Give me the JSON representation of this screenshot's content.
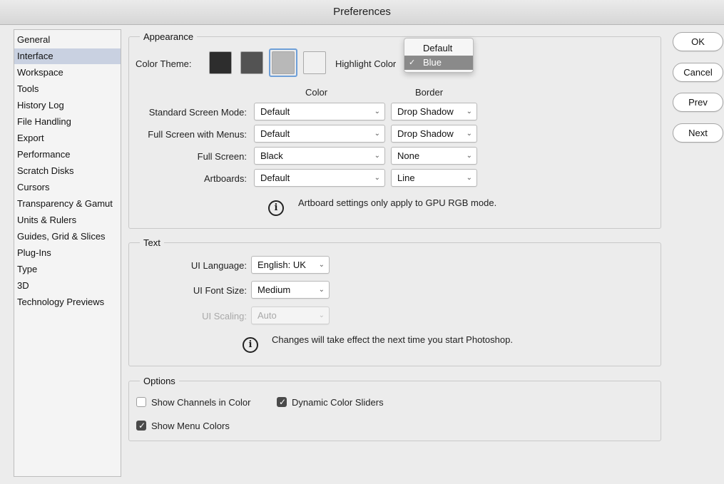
{
  "window": {
    "title": "Preferences"
  },
  "sidebar": {
    "selected": "Interface",
    "items": [
      {
        "label": "General"
      },
      {
        "label": "Interface"
      },
      {
        "label": "Workspace"
      },
      {
        "label": "Tools"
      },
      {
        "label": "History Log"
      },
      {
        "label": "File Handling"
      },
      {
        "label": "Export"
      },
      {
        "label": "Performance"
      },
      {
        "label": "Scratch Disks"
      },
      {
        "label": "Cursors"
      },
      {
        "label": "Transparency & Gamut"
      },
      {
        "label": "Units & Rulers"
      },
      {
        "label": "Guides, Grid & Slices"
      },
      {
        "label": "Plug-Ins"
      },
      {
        "label": "Type"
      },
      {
        "label": "3D"
      },
      {
        "label": "Technology Previews"
      }
    ]
  },
  "appearance": {
    "legend": "Appearance",
    "color_theme_label": "Color Theme:",
    "themes": [
      {
        "color": "#2d2d2d"
      },
      {
        "color": "#535353"
      },
      {
        "color": "#b8b8b8",
        "selected": true
      },
      {
        "color": "#f0f0f0"
      }
    ],
    "highlight_label": "Highlight Color",
    "highlight_popup": {
      "options": [
        "Default",
        "Blue"
      ],
      "selected": "Blue",
      "selected_bg": "#8a8a8a"
    },
    "col_color": "Color",
    "col_border": "Border",
    "rows": [
      {
        "label": "Standard Screen Mode:",
        "color": "Default",
        "border": "Drop Shadow"
      },
      {
        "label": "Full Screen with Menus:",
        "color": "Default",
        "border": "Drop Shadow"
      },
      {
        "label": "Full Screen:",
        "color": "Black",
        "border": "None"
      },
      {
        "label": "Artboards:",
        "color": "Default",
        "border": "Line"
      }
    ],
    "note": "Artboard settings only apply to GPU RGB mode."
  },
  "text": {
    "legend": "Text",
    "ui_language_label": "UI Language:",
    "ui_language_value": "English: UK",
    "ui_font_size_label": "UI Font Size:",
    "ui_font_size_value": "Medium",
    "ui_scaling_label": "UI Scaling:",
    "ui_scaling_value": "Auto",
    "note": "Changes will take effect the next time you start Photoshop."
  },
  "options": {
    "legend": "Options",
    "show_channels_in_color": {
      "label": "Show Channels in Color",
      "checked": false
    },
    "dynamic_color_sliders": {
      "label": "Dynamic Color Sliders",
      "checked": true
    },
    "show_menu_colors": {
      "label": "Show Menu Colors",
      "checked": true
    }
  },
  "buttons": {
    "ok": "OK",
    "cancel": "Cancel",
    "prev": "Prev",
    "next": "Next"
  },
  "icons": {
    "info": "info-icon",
    "chevron": "chevron-down-icon",
    "check": "checkmark-icon"
  },
  "colors": {
    "sidebar_selected": "#c9d1e1",
    "swatch_ring": "#6e9fd8",
    "checkbox_checked": "#4a4a4a"
  }
}
